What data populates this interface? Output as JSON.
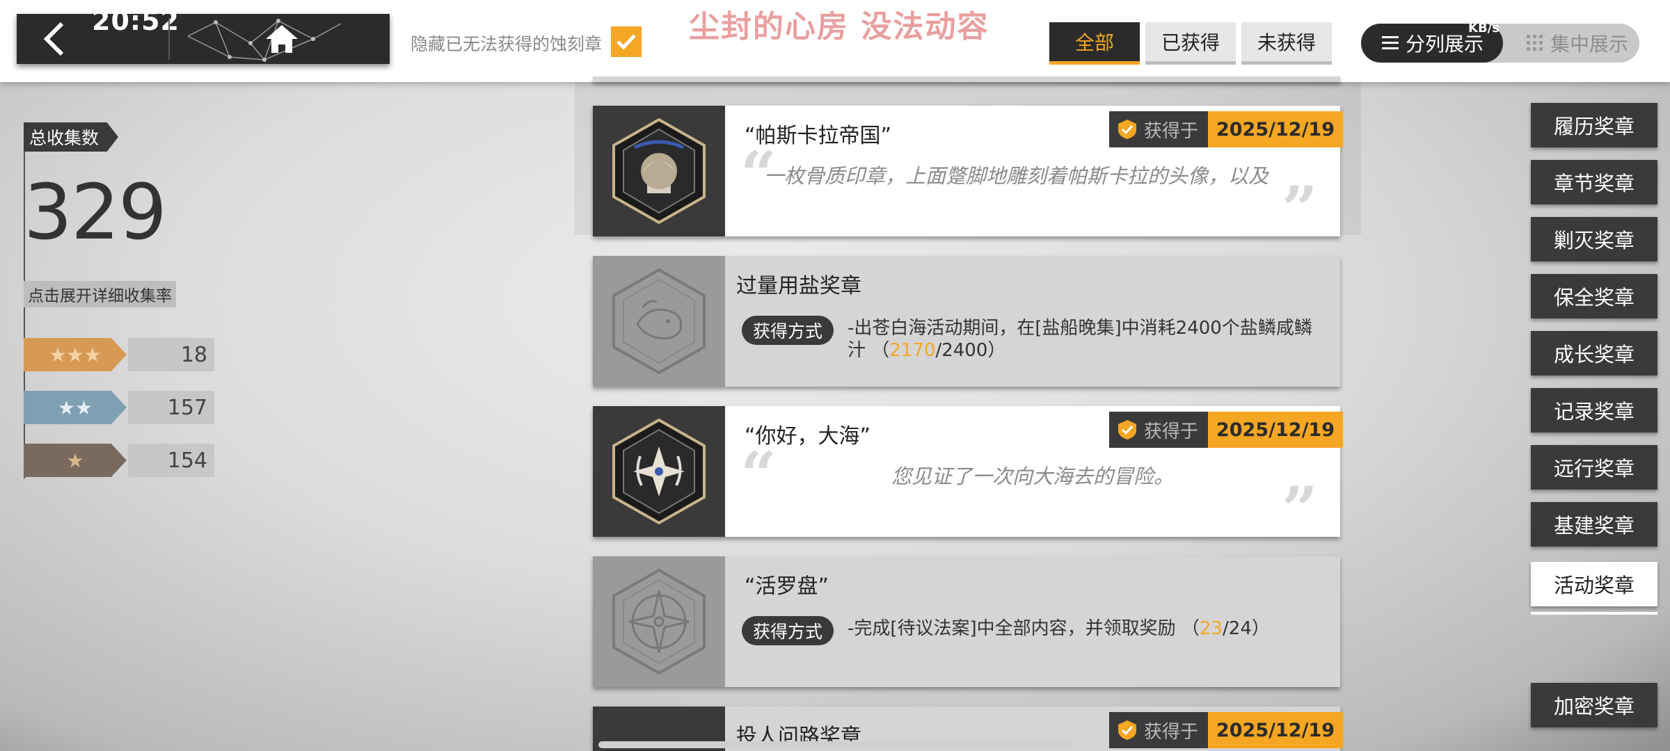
{
  "status": {
    "time": "20:52",
    "network": "KB/s"
  },
  "header": {
    "hide_label": "隐藏已无法获得的蚀刻章",
    "hide_checked": true,
    "title": "尘封的心房 没法动容",
    "filters": [
      "全部",
      "已获得",
      "未获得"
    ],
    "active_filter": "全部",
    "views": {
      "split": "分列展示",
      "focus": "集中展示"
    }
  },
  "stats": {
    "total_label": "总收集数",
    "total": "329",
    "expand_label": "点击展开详细收集率",
    "rarity": [
      {
        "stars": "★★★",
        "count": "18",
        "color": "#d79a55"
      },
      {
        "stars": "★★",
        "count": "157",
        "color": "#7f9fb3"
      },
      {
        "stars": "★",
        "count": "154",
        "color": "#7a6a5e"
      }
    ]
  },
  "medals": [
    {
      "name": "“帕斯卡拉帝国”",
      "earned": true,
      "got_label": "获得于",
      "date": "2025/12/19",
      "quote": "一枚骨质印章，上面蹩脚地雕刻着帕斯卡拉的头像，以及"
    },
    {
      "name": "过量用盐奖章",
      "earned": false,
      "method_label": "获得方式",
      "desc_pre": "-出苍白海活动期间，在[盐船晚集]中消耗2400个盐鳞咸鳞汁 （",
      "progress": "2170",
      "desc_post": "/2400）"
    },
    {
      "name": "“你好，大海”",
      "earned": true,
      "got_label": "获得于",
      "date": "2025/12/19",
      "quote": "您见证了一次向大海去的冒险。"
    },
    {
      "name": "“活罗盘”",
      "earned": false,
      "method_label": "获得方式",
      "desc_pre": "-完成[待议法案]中全部内容，并领取奖励 （",
      "progress": "23",
      "desc_post": "/24）"
    },
    {
      "name": "投人问路奖章",
      "earned": true,
      "got_label": "获得于",
      "date": "2025/12/19"
    }
  ],
  "categories": [
    "履历奖章",
    "章节奖章",
    "剿灭奖章",
    "保全奖章",
    "成长奖章",
    "记录奖章",
    "远行奖章",
    "基建奖章",
    "活动奖章",
    "加密奖章"
  ],
  "active_category": "活动奖章",
  "colors": {
    "accent": "#f5a623",
    "dark": "#2b2b2b",
    "title": "#e9a0a0"
  }
}
